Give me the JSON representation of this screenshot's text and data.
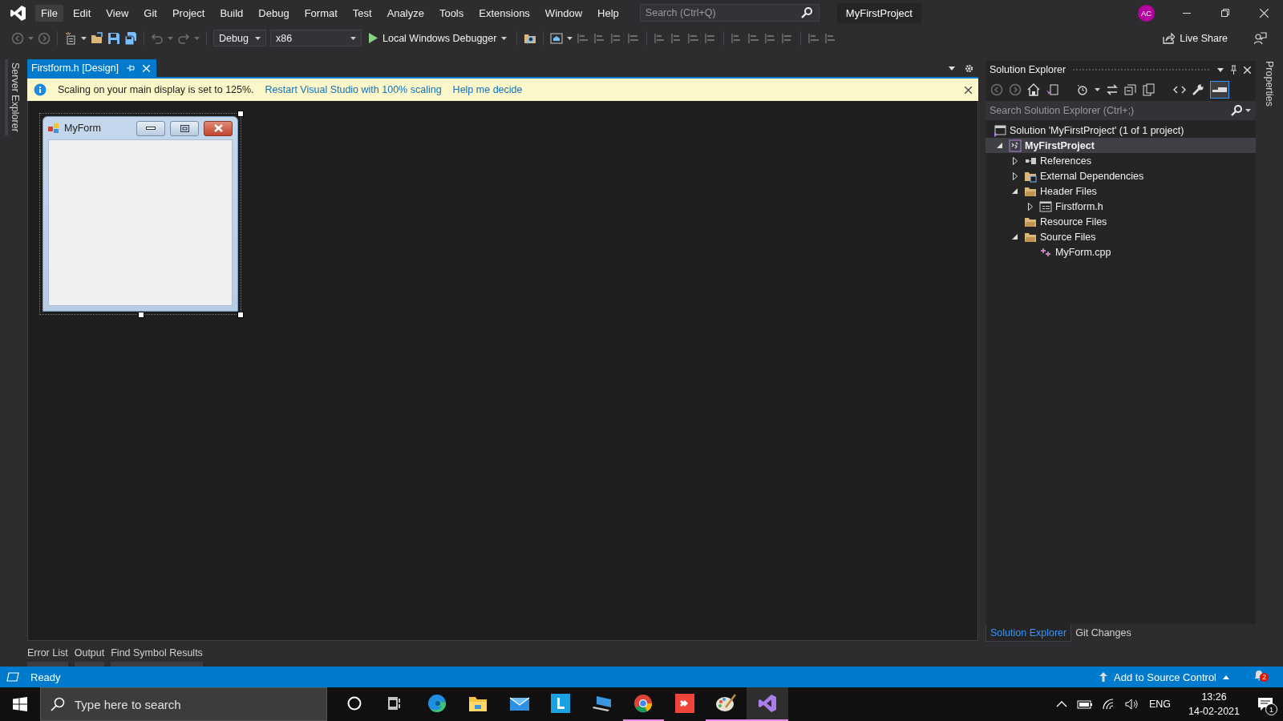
{
  "title_bar": {
    "menu": [
      {
        "label": "File",
        "highlighted": true
      },
      {
        "label": "Edit",
        "highlighted": false
      },
      {
        "label": "View",
        "highlighted": false
      },
      {
        "label": "Git",
        "highlighted": false
      },
      {
        "label": "Project",
        "highlighted": false
      },
      {
        "label": "Build",
        "highlighted": false
      },
      {
        "label": "Debug",
        "highlighted": false
      },
      {
        "label": "Format",
        "highlighted": false
      },
      {
        "label": "Test",
        "highlighted": false
      },
      {
        "label": "Analyze",
        "highlighted": false
      },
      {
        "label": "Tools",
        "highlighted": false
      },
      {
        "label": "Extensions",
        "highlighted": false
      },
      {
        "label": "Window",
        "highlighted": false
      },
      {
        "label": "Help",
        "highlighted": false
      }
    ],
    "search": {
      "placeholder": "Search (Ctrl+Q)"
    },
    "project_name": "MyFirstProject",
    "avatar": "AC"
  },
  "toolbar": {
    "configuration": "Debug",
    "platform": "x86",
    "run_target": "Local Windows Debugger",
    "live_share": "Live Share"
  },
  "left_side_tabs": [
    "Server Explorer"
  ],
  "document_tabs": [
    {
      "label": "Firstform.h [Design]",
      "selected": true
    }
  ],
  "info_bar": {
    "message": "Scaling on your main display is set to 125%.",
    "links": [
      "Restart Visual Studio with 100% scaling",
      "Help me decide"
    ]
  },
  "designer": {
    "form": {
      "title": "MyForm"
    }
  },
  "bottom_tabs": [
    "Error List",
    "Output",
    "Find Symbol Results"
  ],
  "solution_explorer": {
    "title": "Solution Explorer",
    "search": {
      "placeholder": "Search Solution Explorer (Ctrl+;)"
    },
    "tree": [
      {
        "label": "Solution 'MyFirstProject' (1 of 1 project)",
        "kind": "solution",
        "selected": false,
        "children": [
          {
            "label": "MyFirstProject",
            "kind": "project",
            "expanded": true,
            "selected": true,
            "children": [
              {
                "label": "References",
                "kind": "references",
                "expanded": false,
                "selected": false
              },
              {
                "label": "External Dependencies",
                "kind": "external",
                "expanded": false,
                "selected": false
              },
              {
                "label": "Header Files",
                "kind": "folder",
                "expanded": true,
                "selected": false,
                "children": [
                  {
                    "label": "Firstform.h",
                    "kind": "form",
                    "expanded": false,
                    "selected": false
                  }
                ]
              },
              {
                "label": "Resource Files",
                "kind": "folder",
                "selected": false
              },
              {
                "label": "Source Files",
                "kind": "folder",
                "expanded": true,
                "selected": false,
                "children": [
                  {
                    "label": "MyForm.cpp",
                    "kind": "cpp",
                    "selected": false
                  }
                ]
              }
            ]
          }
        ]
      }
    ],
    "tabs": [
      {
        "label": "Solution Explorer",
        "selected": true
      },
      {
        "label": "Git Changes",
        "selected": false
      }
    ]
  },
  "right_side_tabs": [
    "Properties"
  ],
  "status_bar": {
    "text": "Ready",
    "source_control": "Add to Source Control",
    "notifications": "2"
  },
  "taskbar": {
    "search": {
      "placeholder": "Type here to search"
    },
    "apps": [
      {
        "kind": "cortana",
        "running": false,
        "selected": false
      },
      {
        "kind": "taskview",
        "running": false,
        "selected": false
      },
      {
        "kind": "edge",
        "running": false,
        "selected": false
      },
      {
        "kind": "explorer",
        "running": false,
        "selected": false
      },
      {
        "kind": "mail",
        "running": false,
        "selected": false
      },
      {
        "kind": "tile",
        "running": false,
        "selected": false
      },
      {
        "kind": "computer",
        "running": false,
        "selected": false
      },
      {
        "kind": "chrome",
        "running": true,
        "selected": false
      },
      {
        "kind": "remote",
        "running": false,
        "selected": false
      },
      {
        "kind": "paint",
        "running": true,
        "selected": false
      },
      {
        "kind": "vs",
        "running": true,
        "selected": true
      }
    ],
    "language": "ENG",
    "time": "13:26",
    "date": "14-02-2021",
    "action_center_count": "1"
  }
}
